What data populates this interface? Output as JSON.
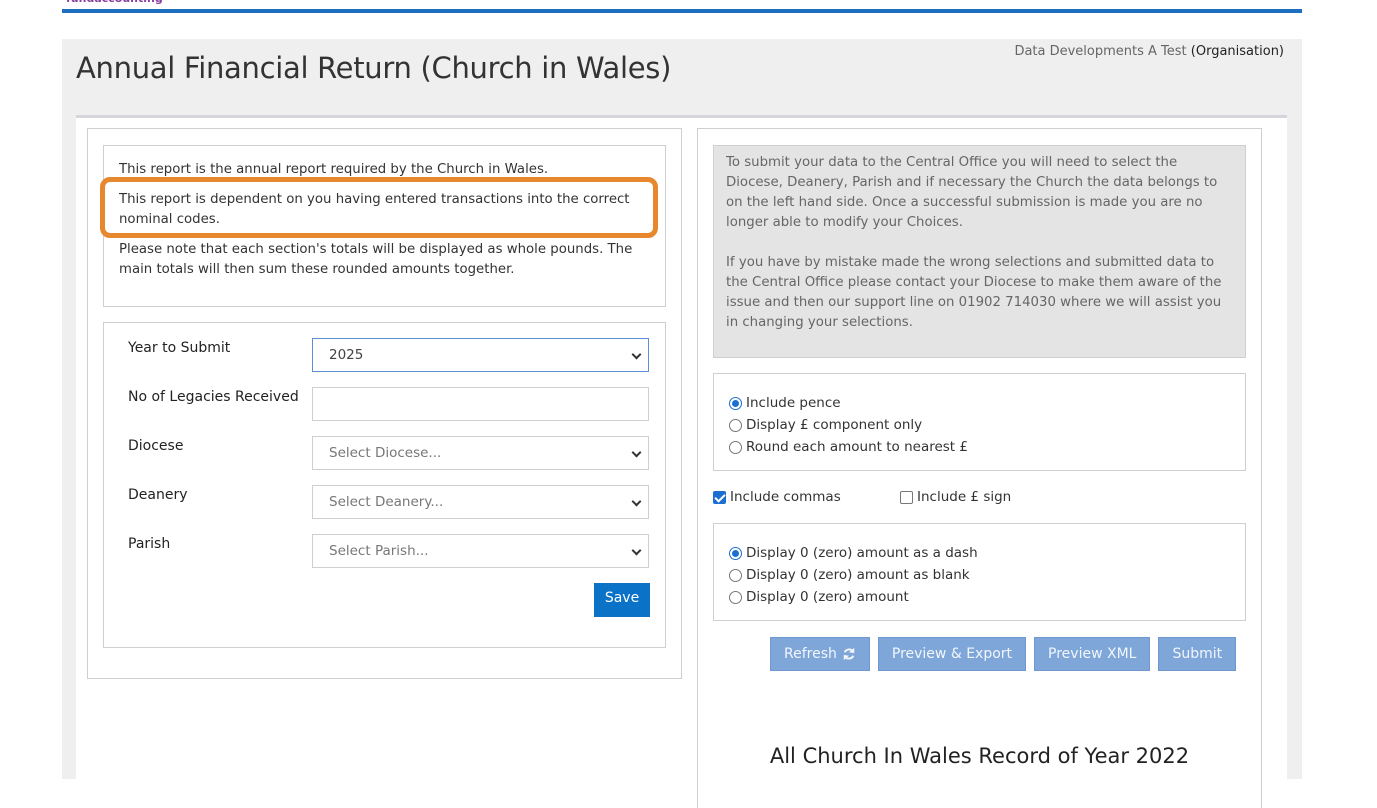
{
  "brand": {
    "name": "fundaccounting"
  },
  "header": {
    "title": "Annual Financial Return (Church in Wales)",
    "org_name": "Data Developments A Test",
    "org_type": "(Organisation)"
  },
  "info": {
    "line1": "This report is the annual report required by the Church in Wales.",
    "line2": "This report is dependent on you having entered transactions into the correct nominal codes.",
    "line3": "Please note that each section's totals will be displayed as whole pounds. The main totals will then sum these rounded amounts together."
  },
  "form": {
    "year_label": "Year to Submit",
    "year_value": "2025",
    "legacies_label": "No of Legacies Received",
    "legacies_value": "",
    "diocese_label": "Diocese",
    "diocese_placeholder": "Select Diocese...",
    "deanery_label": "Deanery",
    "deanery_placeholder": "Select Deanery...",
    "parish_label": "Parish",
    "parish_placeholder": "Select Parish...",
    "save_label": "Save"
  },
  "notice": {
    "para1": "To submit your data to the Central Office  you will need to select the Diocese, Deanery, Parish and if necessary the Church the data belongs to on the left hand side. Once a successful submission is made you are no longer able to modify your Choices.",
    "para2": " If you have by mistake made the wrong selections and submitted data to the Central Office please contact your Diocese to make them aware of the issue and then our support line on 01902 714030 where we will assist you in changing your selections."
  },
  "pence_options": {
    "opt1": "Include pence",
    "opt2": "Display £ component only",
    "opt3": "Round each amount to nearest £",
    "selected": "Include pence"
  },
  "format_options": {
    "commas_label": "Include commas",
    "commas_checked": true,
    "pound_label": "Include £ sign",
    "pound_checked": false
  },
  "zero_options": {
    "opt1": "Display 0 (zero) amount as a dash",
    "opt2": "Display 0 (zero) amount as blank",
    "opt3": "Display 0 (zero) amount",
    "selected": "Display 0 (zero) amount as a dash"
  },
  "actions": {
    "refresh_label": "Refresh",
    "preview_export_label": "Preview & Export",
    "preview_xml_label": "Preview XML",
    "submit_label": "Submit"
  },
  "record": {
    "heading": "All Church In Wales Record of Year 2022"
  },
  "colors": {
    "brand_line": "#1c6ebf",
    "save_button": "#0a73c8",
    "action_button": "#7ea6d8",
    "highlight": "#e8882e"
  }
}
